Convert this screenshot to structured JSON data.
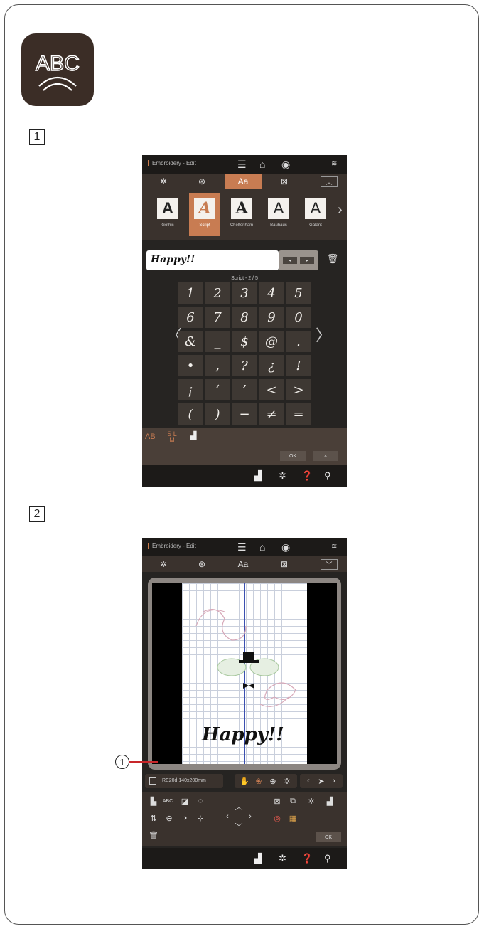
{
  "step_markers": [
    "1",
    "2"
  ],
  "callout_number": "1",
  "icon_tile": {
    "icon": "abc-arc-icon",
    "text": "ABC",
    "bg_color": "#3b2d26"
  },
  "screen1": {
    "title": "Embroidery - Edit",
    "tabs": [
      "Aa"
    ],
    "fonts": [
      {
        "label": "Gothic",
        "glyph": "A"
      },
      {
        "label": "Script",
        "glyph": "A"
      },
      {
        "label": "Cheltenham",
        "glyph": "A"
      },
      {
        "label": "Bauhaus",
        "glyph": "A"
      },
      {
        "label": "Galant",
        "glyph": "A"
      }
    ],
    "active_font": "Script",
    "text_value": "Happy!!",
    "page_indicator": "Script - 2 / 5",
    "keys": [
      [
        "1",
        "2",
        "3",
        "4",
        "5"
      ],
      [
        "6",
        "7",
        "8",
        "9",
        "0"
      ],
      [
        "&",
        "_",
        "$",
        "@",
        "."
      ],
      [
        "•",
        ",",
        "?",
        "¿",
        "!"
      ],
      [
        "¡",
        "‘",
        "’",
        "<",
        ">"
      ],
      [
        "(",
        ")",
        "−",
        "≠",
        "="
      ]
    ],
    "bottom_tools": [
      "AB",
      "S L M"
    ],
    "ok_label": "OK",
    "cancel_label": "×",
    "accent_color": "#c87c52"
  },
  "screen2": {
    "title": "Embroidery - Edit",
    "tab_text": "Aa",
    "design_text": "Happy!!",
    "hoop_label": "RE20d:140x200mm",
    "ok_label": "OK"
  }
}
